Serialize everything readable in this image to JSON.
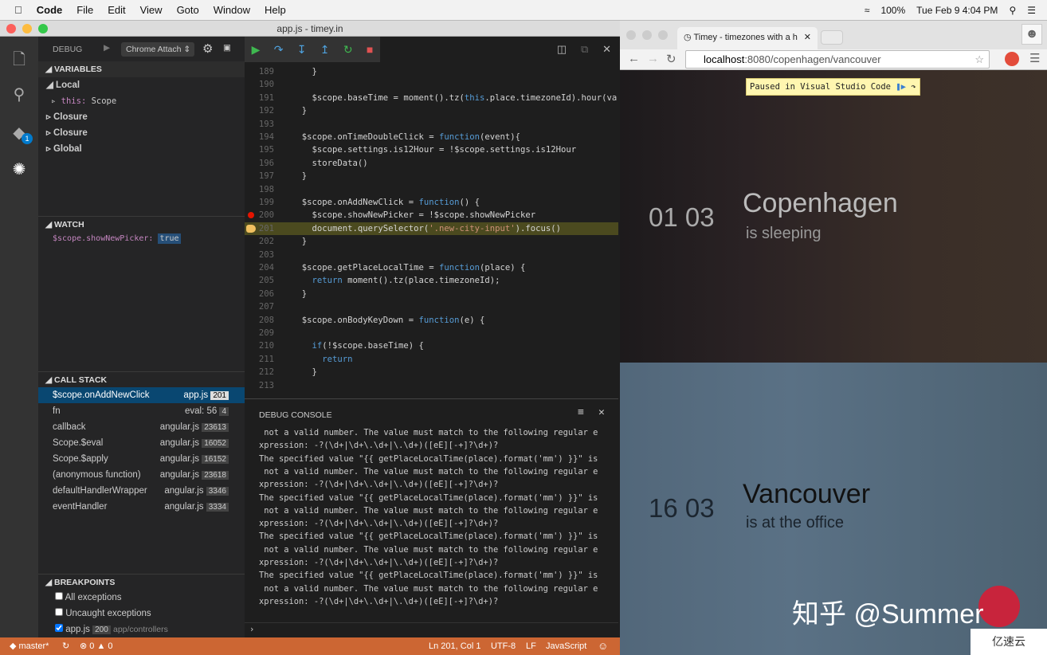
{
  "menubar": {
    "app": "Code",
    "items": [
      "File",
      "Edit",
      "View",
      "Goto",
      "Window",
      "Help"
    ],
    "battery": "100%",
    "clock": "Tue Feb 9  4:04 PM"
  },
  "window": {
    "title": "app.js - timey.in"
  },
  "debug": {
    "label": "DEBUG",
    "config": "Chrome Attach",
    "badge": "1"
  },
  "variables": {
    "header": "VARIABLES",
    "local": "Local",
    "this_key": "this:",
    "this_val": "Scope",
    "scopes": [
      "Closure",
      "Closure",
      "Global"
    ]
  },
  "watch": {
    "header": "WATCH",
    "expr": "$scope.showNewPicker:",
    "value": "true"
  },
  "callstack": {
    "header": "CALL STACK",
    "frames": [
      {
        "name": "$scope.onAddNewClick",
        "file": "app.js",
        "line": "201"
      },
      {
        "name": "fn",
        "file": "eval: 56",
        "line": "4"
      },
      {
        "name": "callback",
        "file": "angular.js",
        "line": "23613"
      },
      {
        "name": "Scope.$eval",
        "file": "angular.js",
        "line": "16052"
      },
      {
        "name": "Scope.$apply",
        "file": "angular.js",
        "line": "16152"
      },
      {
        "name": "(anonymous function)",
        "file": "angular.js",
        "line": "23618"
      },
      {
        "name": "defaultHandlerWrapper",
        "file": "angular.js",
        "line": "3346"
      },
      {
        "name": "eventHandler",
        "file": "angular.js",
        "line": "3334"
      }
    ]
  },
  "breakpoints": {
    "header": "BREAKPOINTS",
    "items": [
      {
        "label": "All exceptions",
        "checked": false
      },
      {
        "label": "Uncaught exceptions",
        "checked": false
      }
    ],
    "file": {
      "name": "app.js",
      "line": "200",
      "path": "app/controllers",
      "checked": true
    }
  },
  "editor": {
    "current_line": "201",
    "breakpoint_line": "200",
    "lines": [
      [
        "189",
        "    }"
      ],
      [
        "190",
        ""
      ],
      [
        "191",
        "    $scope.baseTime = moment().tz(this.place.timezoneId).hour(va"
      ],
      [
        "192",
        "  }"
      ],
      [
        "193",
        ""
      ],
      [
        "194",
        "  $scope.onTimeDoubleClick = function(event){"
      ],
      [
        "195",
        "    $scope.settings.is12Hour = !$scope.settings.is12Hour"
      ],
      [
        "196",
        "    storeData()"
      ],
      [
        "197",
        "  }"
      ],
      [
        "198",
        ""
      ],
      [
        "199",
        "  $scope.onAddNewClick = function() {"
      ],
      [
        "200",
        "    $scope.showNewPicker = !$scope.showNewPicker"
      ],
      [
        "201",
        "    document.querySelector('.new-city-input').focus()"
      ],
      [
        "202",
        "  }"
      ],
      [
        "203",
        ""
      ],
      [
        "204",
        "  $scope.getPlaceLocalTime = function(place) {"
      ],
      [
        "205",
        "    return moment().tz(place.timezoneId);"
      ],
      [
        "206",
        "  }"
      ],
      [
        "207",
        ""
      ],
      [
        "208",
        "  $scope.onBodyKeyDown = function(e) {"
      ],
      [
        "209",
        ""
      ],
      [
        "210",
        "    if(!$scope.baseTime) {"
      ],
      [
        "211",
        "      return"
      ],
      [
        "212",
        "    }"
      ],
      [
        "213",
        ""
      ]
    ]
  },
  "console": {
    "header": "DEBUG CONSOLE",
    "prompt": "›",
    "lines": [
      " not a valid number. The value must match to the following regular e",
      "xpression: -?(\\d+|\\d+\\.\\d+|\\.\\d+)([eE][-+]?\\d+)?",
      "The specified value \"{{ getPlaceLocalTime(place).format('mm') }}\" is",
      " not a valid number. The value must match to the following regular e",
      "xpression: -?(\\d+|\\d+\\.\\d+|\\.\\d+)([eE][-+]?\\d+)?",
      "The specified value \"{{ getPlaceLocalTime(place).format('mm') }}\" is",
      " not a valid number. The value must match to the following regular e",
      "xpression: -?(\\d+|\\d+\\.\\d+|\\.\\d+)([eE][-+]?\\d+)?",
      "The specified value \"{{ getPlaceLocalTime(place).format('mm') }}\" is",
      " not a valid number. The value must match to the following regular e",
      "xpression: -?(\\d+|\\d+\\.\\d+|\\.\\d+)([eE][-+]?\\d+)?",
      "The specified value \"{{ getPlaceLocalTime(place).format('mm') }}\" is",
      " not a valid number. The value must match to the following regular e",
      "xpression: -?(\\d+|\\d+\\.\\d+|\\.\\d+)([eE][-+]?\\d+)?"
    ]
  },
  "status": {
    "branch": "master*",
    "errors": "0",
    "warnings": "0",
    "position": "Ln 201, Col 1",
    "encoding": "UTF-8",
    "eol": "LF",
    "language": "JavaScript",
    "color": "#cc6633"
  },
  "browser": {
    "tab_title": "Timey - timezones with a h",
    "url_host": "localhost",
    "url_rest": ":8080/copenhagen/vancouver",
    "paused": "Paused in Visual Studio Code",
    "cities": [
      {
        "time": "01 03",
        "name": "Copenhagen",
        "status": "is sleeping"
      },
      {
        "time": "16 03",
        "name": "Vancouver",
        "status": "is at the office"
      }
    ]
  },
  "watermark": {
    "text": "知乎 @Summer",
    "logo": "亿速云"
  }
}
